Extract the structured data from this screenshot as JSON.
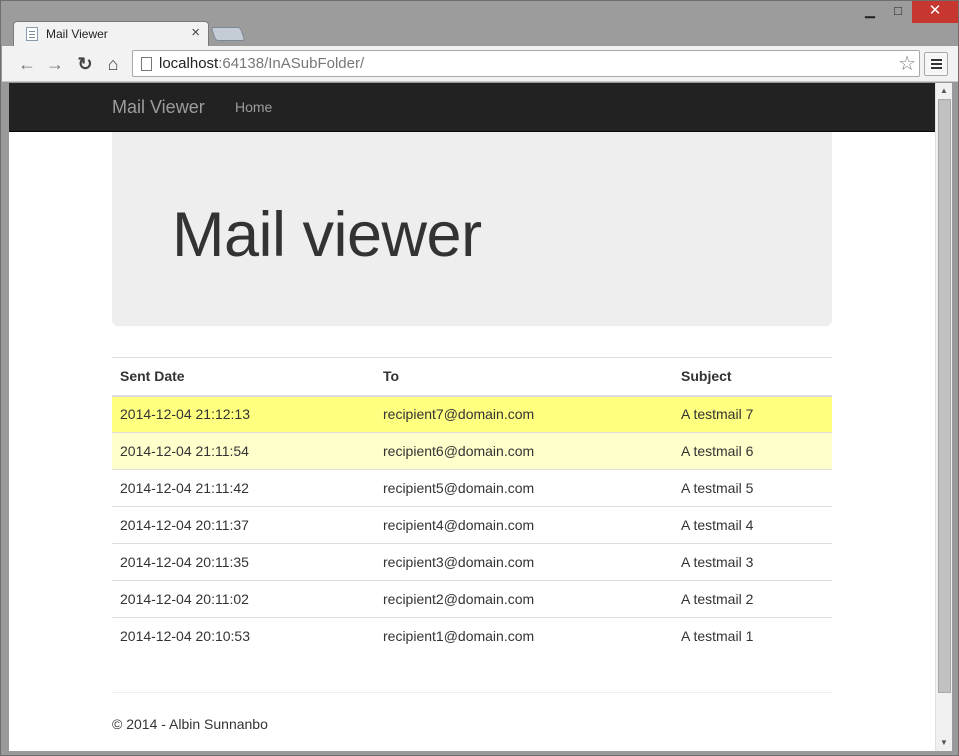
{
  "browser": {
    "tab_title": "Mail Viewer",
    "tab_close": "×",
    "url_host": "localhost",
    "url_rest": ":64138/InASubFolder/",
    "back_icon": "back-arrow-icon",
    "forward_icon": "forward-arrow-icon",
    "reload_icon": "reload-icon",
    "home_icon": "home-icon",
    "star_icon": "bookmark-star-icon",
    "menu_icon": "hamburger-menu-icon",
    "minimize": "▁",
    "maximize": "□",
    "close": "✕"
  },
  "navbar": {
    "brand": "Mail Viewer",
    "links": [
      "Home"
    ]
  },
  "jumbotron": {
    "title": "Mail viewer"
  },
  "table": {
    "headers": [
      "Sent Date",
      "To",
      "Subject"
    ],
    "rows": [
      {
        "date": "2014-12-04 21:12:13",
        "to": "recipient7@domain.com",
        "subject": "A testmail 7"
      },
      {
        "date": "2014-12-04 21:11:54",
        "to": "recipient6@domain.com",
        "subject": "A testmail 6"
      },
      {
        "date": "2014-12-04 21:11:42",
        "to": "recipient5@domain.com",
        "subject": "A testmail 5"
      },
      {
        "date": "2014-12-04 20:11:37",
        "to": "recipient4@domain.com",
        "subject": "A testmail 4"
      },
      {
        "date": "2014-12-04 20:11:35",
        "to": "recipient3@domain.com",
        "subject": "A testmail 3"
      },
      {
        "date": "2014-12-04 20:11:02",
        "to": "recipient2@domain.com",
        "subject": "A testmail 2"
      },
      {
        "date": "2014-12-04 20:10:53",
        "to": "recipient1@domain.com",
        "subject": "A testmail 1"
      }
    ],
    "highlight_colors": {
      "newest": "#ffff80",
      "recent": "#ffffcc"
    }
  },
  "footer": {
    "text": "© 2014 - Albin Sunnanbo"
  }
}
